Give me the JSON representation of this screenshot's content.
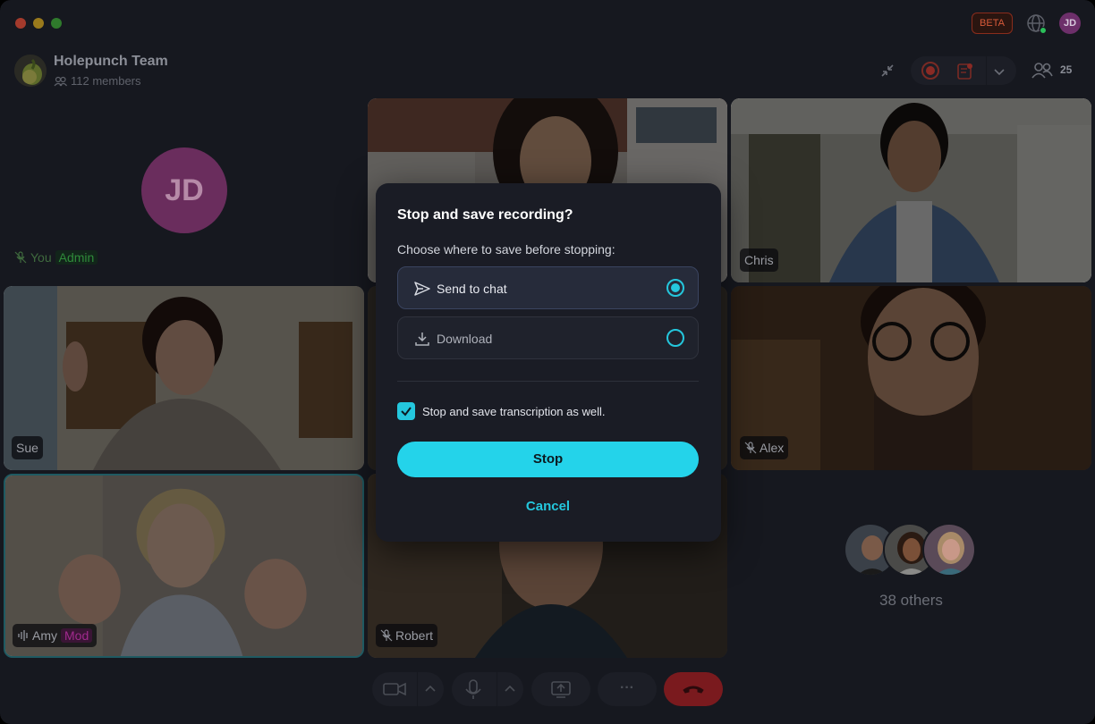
{
  "titlebar": {
    "beta_label": "BETA",
    "user_initials": "JD"
  },
  "header": {
    "team_name": "Holepunch Team",
    "members_label": "112 members",
    "participants_count": "25"
  },
  "tiles": {
    "self": {
      "initials": "JD",
      "name": "You",
      "badge": "Admin"
    },
    "chris": {
      "name": "Chris"
    },
    "sue": {
      "name": "Sue"
    },
    "alex": {
      "name": "Alex"
    },
    "amy": {
      "name": "Amy",
      "badge": "Mod"
    },
    "robert": {
      "name": "Robert"
    },
    "others": {
      "label": "38 others"
    }
  },
  "modal": {
    "title": "Stop and save recording?",
    "subtitle": "Choose where to save before stopping:",
    "options": [
      {
        "label": "Send to chat",
        "icon": "send-icon",
        "selected": true
      },
      {
        "label": "Download",
        "icon": "download-icon",
        "selected": false
      }
    ],
    "checkbox_label": "Stop and save transcription as well.",
    "checkbox_checked": true,
    "stop_label": "Stop",
    "cancel_label": "Cancel"
  },
  "controls": {
    "ellipsis": "···"
  },
  "colors": {
    "accent": "#24d3ea",
    "admin": "#2f8b3a",
    "mod": "#a12a8e",
    "hangup": "#7a1a1e"
  }
}
